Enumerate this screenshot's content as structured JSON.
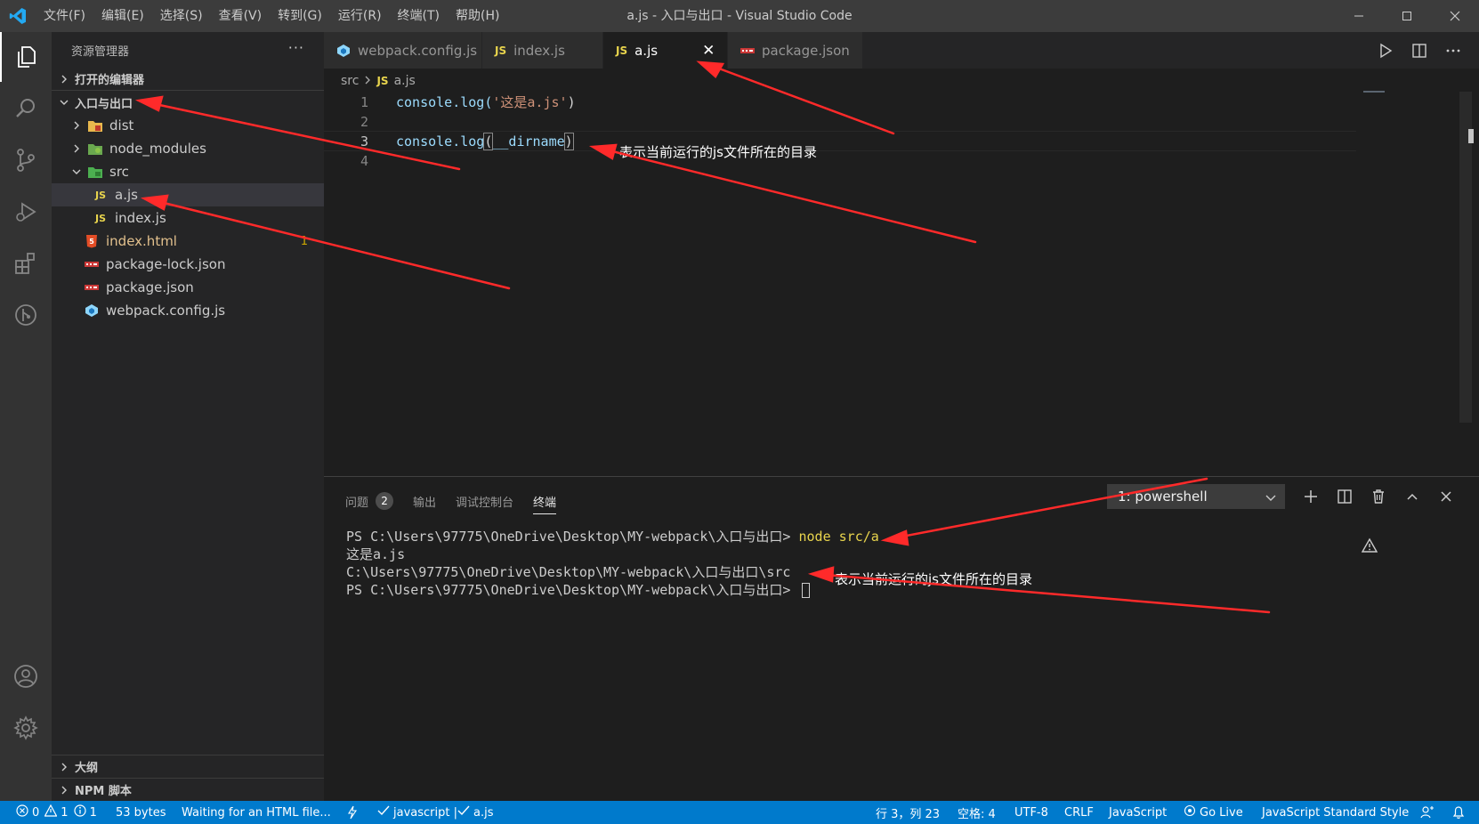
{
  "titlebar": {
    "menu": [
      "文件(F)",
      "编辑(E)",
      "选择(S)",
      "查看(V)",
      "转到(G)",
      "运行(R)",
      "终端(T)",
      "帮助(H)"
    ],
    "title": "a.js - 入口与出口 - Visual Studio Code"
  },
  "sidebar": {
    "title": "资源管理器",
    "open_editors": "打开的编辑器",
    "project": "入口与出口",
    "items": [
      {
        "label": "dist"
      },
      {
        "label": "node_modules"
      },
      {
        "label": "src"
      },
      {
        "label": "a.js"
      },
      {
        "label": "index.js"
      },
      {
        "label": "index.html",
        "badge": "1"
      },
      {
        "label": "package-lock.json"
      },
      {
        "label": "package.json"
      },
      {
        "label": "webpack.config.js"
      }
    ],
    "outline": "大纲",
    "npm_scripts": "NPM 脚本"
  },
  "tabs": [
    {
      "label": "webpack.config.js"
    },
    {
      "label": "index.js"
    },
    {
      "label": "a.js"
    },
    {
      "label": "package.json"
    }
  ],
  "breadcrumb": {
    "folder": "src",
    "file": "a.js"
  },
  "code": {
    "line_numbers": [
      "1",
      "2",
      "3",
      "4"
    ],
    "line1_fn": "console.log(",
    "line1_str": "'这是a.js'",
    "line1_end": ")",
    "line3_fn": "console.log",
    "line3_open": "(",
    "line3_arg": "__dirname",
    "line3_close": ")"
  },
  "annotations": {
    "editor_note": "表示当前运行的js文件所在的目录",
    "terminal_note": "表示当前运行的js文件所在的目录"
  },
  "panel": {
    "tabs": [
      {
        "label": "问题",
        "count": "2"
      },
      {
        "label": "输出"
      },
      {
        "label": "调试控制台"
      },
      {
        "label": "终端"
      }
    ],
    "terminal_select": "1: powershell",
    "terminal_lines": {
      "prompt1": "PS C:\\Users\\97775\\OneDrive\\Desktop\\MY-webpack\\入口与出口> ",
      "cmd1": "node src/a",
      "out1": "这是a.js",
      "out2": "C:\\Users\\97775\\OneDrive\\Desktop\\MY-webpack\\入口与出口\\src",
      "prompt2": "PS C:\\Users\\97775\\OneDrive\\Desktop\\MY-webpack\\入口与出口> "
    }
  },
  "statusbar": {
    "errors": "0",
    "warnings": "1",
    "infos": "1",
    "size": "53 bytes",
    "waiting": "Waiting for an HTML file...",
    "lint": "javascript | ",
    "lint_file": "a.js",
    "position": "行 3，列 23",
    "spaces": "空格: 4",
    "encoding": "UTF-8",
    "eol": "CRLF",
    "language": "JavaScript",
    "golive": "Go Live",
    "style": "JavaScript Standard Style"
  },
  "colors": {
    "accent": "#007acc",
    "arrow": "#ff2a2a",
    "js_icon": "#e8d44d"
  }
}
